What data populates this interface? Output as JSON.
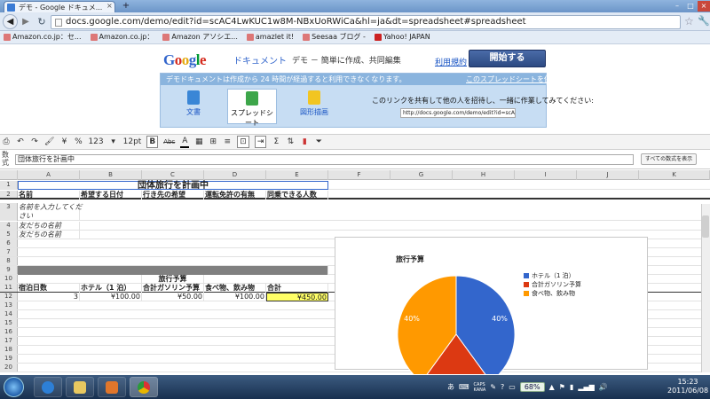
{
  "browser": {
    "tab_title": "デモ - Google ドキュメ...",
    "tab_close": "×",
    "new_tab": "+",
    "url": "docs.google.com/demo/edit?id=scAC4LwKUC1w8M-NBxUoRWiCa&hl=ja&dt=spreadsheet#spreadsheet",
    "bookmarks": [
      {
        "label": "Amazon.co.jp：セ..."
      },
      {
        "label": "Amazon.co.jp："
      },
      {
        "label": "Amazon アソシエ..."
      },
      {
        "label": "amazlet it!"
      },
      {
        "label": "Seesaa ブログ -"
      },
      {
        "label": "Yahoo! JAPAN"
      }
    ]
  },
  "banner": {
    "logo": {
      "G": "G",
      "o1": "o",
      "o2": "o",
      "g": "g",
      "l": "l",
      "e": "e"
    },
    "docs_label": "ドキュメント",
    "tagline": "デモ － 簡単に作成、共同編集",
    "terms_link": "利用規約",
    "start_button": "開始する",
    "notice": "デモドキュメントは作成から 24 時間が経過すると利用できなくなります。",
    "save_link": "このスプレッドシートを保存",
    "products": [
      {
        "label": "文書"
      },
      {
        "label": "スプレッドシート"
      },
      {
        "label": "図形描画"
      }
    ],
    "share_text": "このリンクを共有して他の人を招待し、一緒に作業してみてください:",
    "share_url": "http://docs.google.com/demo/edit?id=scAC4Lw"
  },
  "toolbar": {
    "percent": "%",
    "number_format": "123",
    "font_size": "12pt",
    "bold": "B",
    "strike": "Abc",
    "text_color": "A",
    "yen": "¥"
  },
  "formula": {
    "label": "数式",
    "value": "団体旅行を計画中",
    "show_formulas": "すべての数式を表示"
  },
  "columns": [
    "A",
    "B",
    "C",
    "D",
    "E",
    "F",
    "G",
    "H",
    "I",
    "J",
    "K"
  ],
  "rows": {
    "r1": {
      "num": "1",
      "title": "団体旅行を計画中"
    },
    "r2": {
      "num": "2",
      "a": "名前",
      "b": "希望する日付",
      "c": "行き先の希望",
      "d": "運転免許の有無",
      "e": "同乗できる人数"
    },
    "r3": {
      "num": "3",
      "a": "名前を入力してくだ"
    },
    "r3b": {
      "a": "さい"
    },
    "r4": {
      "num": "4",
      "a": "友だちの名前"
    },
    "r5": {
      "num": "5",
      "a": "友だちの名前"
    },
    "r6": {
      "num": "6"
    },
    "r7": {
      "num": "7"
    },
    "r8": {
      "num": "8"
    },
    "r9": {
      "num": "9"
    },
    "r10": {
      "num": "10",
      "c": "旅行予算"
    },
    "r11": {
      "num": "11",
      "a": "宿泊日数",
      "b": "ホテル（1 泊）",
      "c": "合計ガソリン予算",
      "d": "食べ物、飲み物",
      "e": "合計"
    },
    "r12": {
      "num": "12",
      "a": "3",
      "b": "¥100.00",
      "c": "¥50.00",
      "d": "¥100.00",
      "e": "¥450.00"
    },
    "r13": {
      "num": "13"
    },
    "r14": {
      "num": "14"
    },
    "r15": {
      "num": "15"
    },
    "r16": {
      "num": "16"
    },
    "r17": {
      "num": "17"
    },
    "r18": {
      "num": "18"
    },
    "r19": {
      "num": "19"
    },
    "r20": {
      "num": "20"
    }
  },
  "chart_data": {
    "type": "pie",
    "title": "旅行予算",
    "slices": [
      {
        "label": "ホテル（1 泊）",
        "value": 40,
        "color": "#3366cc"
      },
      {
        "label": "合計ガソリン予算",
        "value": 20,
        "color": "#dc3912"
      },
      {
        "label": "食べ物、飲み物",
        "value": 40,
        "color": "#ff9900"
      }
    ],
    "data_labels": [
      "40%",
      "40%"
    ],
    "legend_position": "right"
  },
  "taskbar": {
    "tray_lang": "あ",
    "caps": "CAPS",
    "kana": "KANA",
    "battery": "68%",
    "time": "15:23",
    "date": "2011/06/08"
  }
}
